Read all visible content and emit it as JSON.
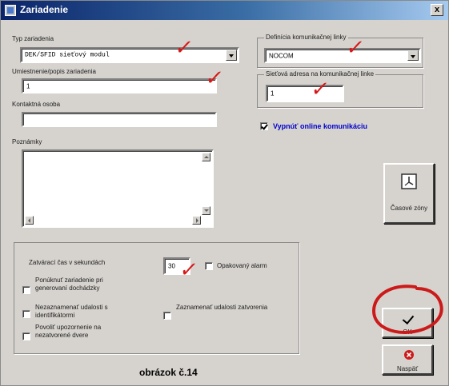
{
  "window": {
    "title": "Zariadenie",
    "close_label": "x"
  },
  "device_type": {
    "label": "Typ zariadenia",
    "value": "DEK/SFID sieťový modul"
  },
  "location": {
    "label": "Umiestnenie/popis zariadenia",
    "value": "1"
  },
  "contact": {
    "label": "Kontaktná osoba",
    "value": ""
  },
  "notes": {
    "label": "Poznámky",
    "value": ""
  },
  "comm_line": {
    "label": "Definícia komunikačnej linky",
    "value": "NOCOM"
  },
  "network_address": {
    "label": "Sieťová adresa na komunikačnej linke",
    "value": "1"
  },
  "disable_online": {
    "label": "Vypnúť online komunikáciu",
    "checked": true,
    "color": "#0000cc"
  },
  "time_zones_button": {
    "label": "Časové zóny"
  },
  "lock_group": {
    "closing_time_label": "Zatvárací čas v sekundách",
    "closing_time_value": "30",
    "repeated_alarm_label": "Opakovaný alarm",
    "offer_for_attendance_label": "Ponúknuť zariadenie pri generovaní dochádzky",
    "no_record_id_events_label": "Nezaznamenať udalosti s identifikátormi",
    "allow_unclosed_door_warning_label": "Povoliť upozornenie na nezatvorené dvere",
    "record_closing_events_label": "Zaznamenať udalosti zatvorenia"
  },
  "ok_button": {
    "label": "OK"
  },
  "back_button": {
    "label": "Naspäť"
  },
  "caption": "obrázok č.14",
  "annotations": {
    "tick_glyph": "✓",
    "tick_color": "#d81818",
    "circle_color": "#cc1a1a"
  }
}
